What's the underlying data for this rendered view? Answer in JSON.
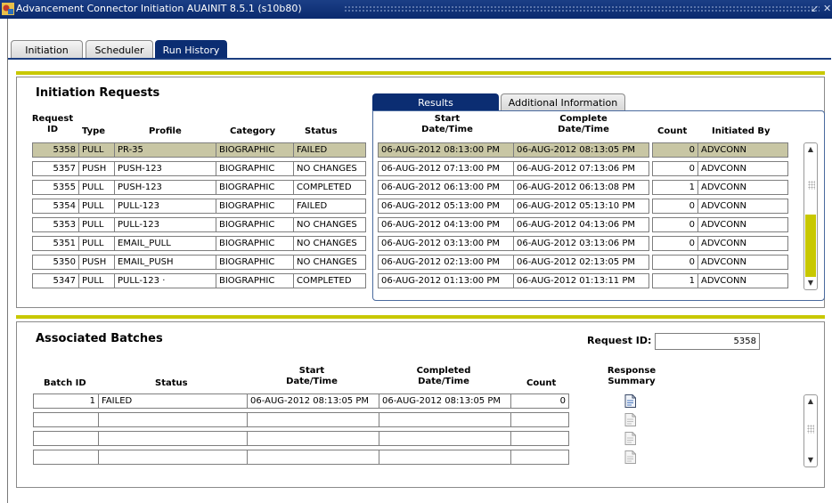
{
  "window": {
    "title": "Advancement Connector Initiation  AUAINIT  8.5.1  (s10b80)",
    "colors": {
      "titlebar": "#0a2a6e",
      "active_tab": "#0b2d72",
      "selected_row": "#c8c6a4",
      "divider": "#c8c800"
    }
  },
  "tabs": [
    {
      "label": "Initiation",
      "active": false
    },
    {
      "label": "Scheduler",
      "active": false
    },
    {
      "label": "Run History",
      "active": true
    }
  ],
  "requests": {
    "heading": "Initiation Requests",
    "headers": {
      "request_id_1": "Request",
      "request_id_2": "ID",
      "type": "Type",
      "profile": "Profile",
      "category": "Category",
      "status": "Status"
    },
    "rows": [
      {
        "id": "5358",
        "type": "PULL",
        "profile": "PR-35",
        "category": "BIOGRAPHIC",
        "status": "FAILED",
        "selected": true
      },
      {
        "id": "5357",
        "type": "PUSH",
        "profile": "PUSH-123",
        "category": "BIOGRAPHIC",
        "status": "NO CHANGES"
      },
      {
        "id": "5355",
        "type": "PULL",
        "profile": "PUSH-123",
        "category": "BIOGRAPHIC",
        "status": "COMPLETED"
      },
      {
        "id": "5354",
        "type": "PULL",
        "profile": "PULL-123",
        "category": "BIOGRAPHIC",
        "status": "FAILED"
      },
      {
        "id": "5353",
        "type": "PULL",
        "profile": "PULL-123",
        "category": "BIOGRAPHIC",
        "status": "NO CHANGES"
      },
      {
        "id": "5351",
        "type": "PULL",
        "profile": "EMAIL_PULL",
        "category": "BIOGRAPHIC",
        "status": "NO CHANGES"
      },
      {
        "id": "5350",
        "type": "PUSH",
        "profile": "EMAIL_PUSH",
        "category": "BIOGRAPHIC",
        "status": "NO CHANGES"
      },
      {
        "id": "5347",
        "type": "PULL",
        "profile": "PULL-123 ·",
        "category": "BIOGRAPHIC",
        "status": "COMPLETED"
      }
    ]
  },
  "results": {
    "tabs": [
      {
        "label": "Results",
        "active": true
      },
      {
        "label": "Additional Information",
        "active": false
      }
    ],
    "headers": {
      "start_1": "Start",
      "start_2": "Date/Time",
      "complete_1": "Complete",
      "complete_2": "Date/Time",
      "count": "Count",
      "initiated_by": "Initiated By"
    },
    "rows": [
      {
        "start": "06-AUG-2012 08:13:00 PM",
        "complete": "06-AUG-2012 08:13:05 PM",
        "count": "0",
        "by": "ADVCONN",
        "selected": true
      },
      {
        "start": "06-AUG-2012 07:13:00 PM",
        "complete": "06-AUG-2012 07:13:06 PM",
        "count": "0",
        "by": "ADVCONN"
      },
      {
        "start": "06-AUG-2012 06:13:00 PM",
        "complete": "06-AUG-2012 06:13:08 PM",
        "count": "1",
        "by": "ADVCONN"
      },
      {
        "start": "06-AUG-2012 05:13:00 PM",
        "complete": "06-AUG-2012 05:13:10 PM",
        "count": "0",
        "by": "ADVCONN"
      },
      {
        "start": "06-AUG-2012 04:13:00 PM",
        "complete": "06-AUG-2012 04:13:06 PM",
        "count": "0",
        "by": "ADVCONN"
      },
      {
        "start": "06-AUG-2012 03:13:00 PM",
        "complete": "06-AUG-2012 03:13:06 PM",
        "count": "0",
        "by": "ADVCONN"
      },
      {
        "start": "06-AUG-2012 02:13:00 PM",
        "complete": "06-AUG-2012 02:13:05 PM",
        "count": "0",
        "by": "ADVCONN"
      },
      {
        "start": "06-AUG-2012 01:13:00 PM",
        "complete": "06-AUG-2012 01:13:11 PM",
        "count": "1",
        "by": "ADVCONN"
      }
    ]
  },
  "batches": {
    "heading": "Associated Batches",
    "request_id_label": "Request ID:",
    "request_id_value": "5358",
    "headers": {
      "batch_id": "Batch ID",
      "status": "Status",
      "start_1": "Start",
      "start_2": "Date/Time",
      "completed_1": "Completed",
      "completed_2": "Date/Time",
      "count": "Count",
      "response_1": "Response",
      "response_2": "Summary"
    },
    "rows": [
      {
        "batch_id": "1",
        "status": "FAILED",
        "start": "06-AUG-2012 08:13:05 PM",
        "completed": "06-AUG-2012 08:13:05 PM",
        "count": "0",
        "icon": "document-icon"
      },
      {
        "batch_id": "",
        "status": "",
        "start": "",
        "completed": "",
        "count": "",
        "icon": "document-icon"
      },
      {
        "batch_id": "",
        "status": "",
        "start": "",
        "completed": "",
        "count": "",
        "icon": "document-icon"
      },
      {
        "batch_id": "",
        "status": "",
        "start": "",
        "completed": "",
        "count": "",
        "icon": "document-icon"
      }
    ]
  },
  "icons": {
    "app": "app-icon",
    "title_buttons": [
      "minimize-icon",
      "close-icon"
    ],
    "scroll_up": "scroll-up-icon",
    "scroll_down": "scroll-down-icon",
    "response": "document-icon"
  }
}
